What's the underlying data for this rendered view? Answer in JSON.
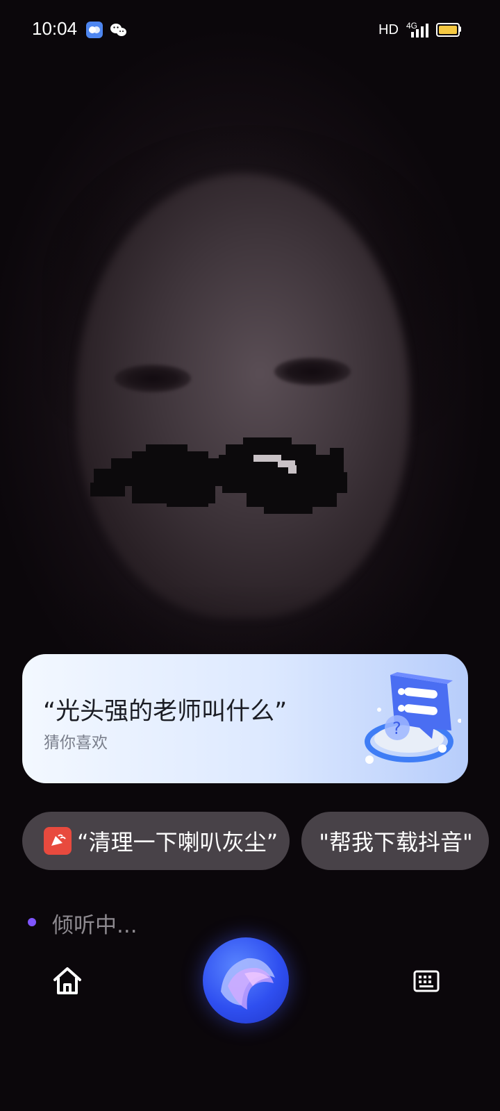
{
  "status_bar": {
    "time": "10:04",
    "network_type": "HD",
    "signal_label": "4G",
    "battery_color": "#f5c842",
    "icons": [
      "t-box-icon",
      "wechat-icon",
      "signal-icon",
      "battery-icon"
    ]
  },
  "suggestion_card": {
    "title": "“光头强的老师叫什么”",
    "subtitle": "猜你喜欢",
    "illustration": "chat-question-illustration"
  },
  "chips": [
    {
      "label": "“清理一下喇叭灰尘”",
      "icon": "speaker-clean-icon",
      "icon_color": "#e84a3e"
    },
    {
      "label": "\"帮我下载抖音\""
    }
  ],
  "listening": {
    "text": "倾听中...",
    "dot_color": "#7f55ff"
  },
  "bottom_nav": {
    "home_icon": "home-icon",
    "assistant_icon": "voice-assistant-orb-icon",
    "keyboard_icon": "keyboard-icon"
  },
  "colors": {
    "orb": "#2f4ff0",
    "card_gradient_end": "#b7cdfb"
  }
}
